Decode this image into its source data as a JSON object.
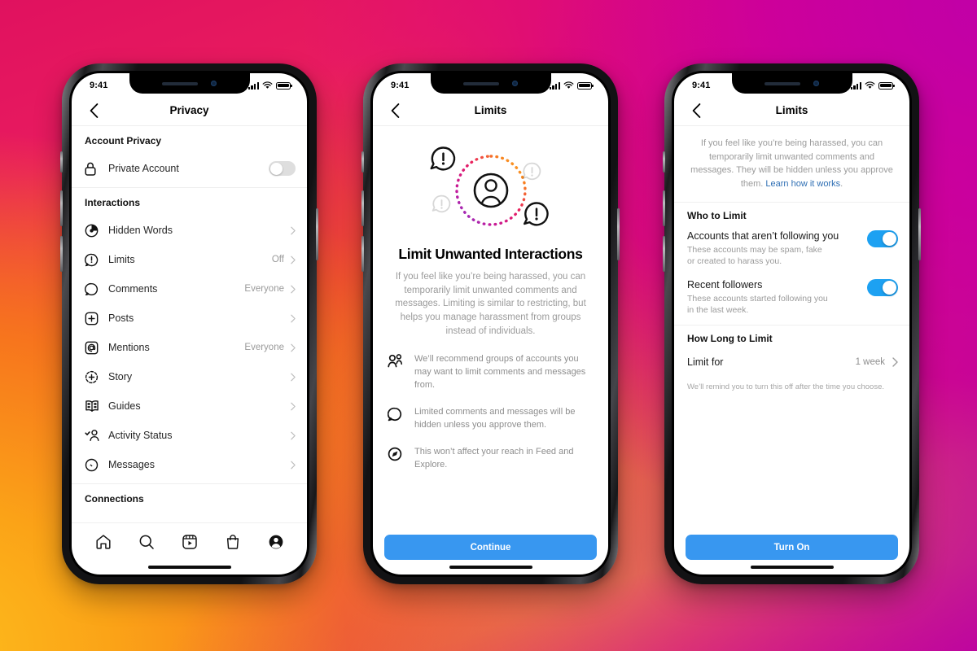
{
  "background": {
    "gradient_from": "#e0115f",
    "gradient_mid": "#f8891c",
    "gradient_to": "#b800b0"
  },
  "theme": {
    "accent_blue": "#3897f0",
    "toggle_on_blue": "#1da1f2",
    "toggle_off_gray": "#dedede",
    "link_blue": "#2f6fb4",
    "text_primary": "#262626",
    "text_muted": "#9b9b9b"
  },
  "phones": [
    {
      "id": "phone-privacy",
      "status_bar": {
        "time": "9:41",
        "signal": "signal-bars-icon",
        "wifi": "wifi-icon",
        "battery": "battery-full-icon"
      },
      "nav": {
        "back": "chevron-left-icon",
        "title": "Privacy"
      },
      "sections": [
        {
          "id": "account-privacy",
          "header": "Account Privacy",
          "rows": [
            {
              "icon": "lock-icon",
              "label": "Private Account",
              "value": "",
              "control": "toggle-off"
            }
          ]
        },
        {
          "id": "interactions",
          "header": "Interactions",
          "rows": [
            {
              "icon": "hidden-words-icon",
              "label": "Hidden Words",
              "value": "",
              "control": "chevron"
            },
            {
              "icon": "limits-icon",
              "label": "Limits",
              "value": "Off",
              "control": "chevron"
            },
            {
              "icon": "comment-icon",
              "label": "Comments",
              "value": "Everyone",
              "control": "chevron"
            },
            {
              "icon": "posts-plus-icon",
              "label": "Posts",
              "value": "",
              "control": "chevron"
            },
            {
              "icon": "mentions-at-icon",
              "label": "Mentions",
              "value": "Everyone",
              "control": "chevron"
            },
            {
              "icon": "story-plus-icon",
              "label": "Story",
              "value": "",
              "control": "chevron"
            },
            {
              "icon": "guides-book-icon",
              "label": "Guides",
              "value": "",
              "control": "chevron"
            },
            {
              "icon": "activity-status-icon",
              "label": "Activity Status",
              "value": "",
              "control": "chevron"
            },
            {
              "icon": "messenger-icon",
              "label": "Messages",
              "value": "",
              "control": "chevron"
            }
          ]
        },
        {
          "id": "connections",
          "header": "Connections",
          "rows": []
        }
      ],
      "tabbar": [
        {
          "icon": "home-icon",
          "name": "tab-home"
        },
        {
          "icon": "search-icon",
          "name": "tab-search"
        },
        {
          "icon": "reels-icon",
          "name": "tab-reels"
        },
        {
          "icon": "shop-bag-icon",
          "name": "tab-shop"
        },
        {
          "icon": "profile-avatar-icon",
          "name": "tab-profile"
        }
      ]
    },
    {
      "id": "phone-limits-intro",
      "status_bar": {
        "time": "9:41"
      },
      "nav": {
        "back": "chevron-left-icon",
        "title": "Limits"
      },
      "illustration": {
        "name": "limit-unwanted-interactions-illustration",
        "center_icon": "person-circle-icon",
        "ring": "dotted-gradient-ring",
        "bubbles": [
          "exclamation-bubble-dark",
          "exclamation-bubble-faint",
          "exclamation-bubble-faint",
          "exclamation-bubble-dark"
        ]
      },
      "title": "Limit Unwanted Interactions",
      "subtitle": "If you feel like you’re being harassed, you can temporarily limit unwanted comments and messages. Limiting is similar to restricting, but helps you manage harassment from groups instead of individuals.",
      "features": [
        {
          "icon": "two-people-icon",
          "text": "We’ll recommend groups of accounts you may want to limit comments and messages from."
        },
        {
          "icon": "comment-bubble-icon",
          "text": "Limited comments and messages will be hidden unless you approve them."
        },
        {
          "icon": "compass-explore-icon",
          "text": "This won’t affect your reach in Feed and Explore."
        }
      ],
      "cta": {
        "label": "Continue"
      }
    },
    {
      "id": "phone-limits-settings",
      "status_bar": {
        "time": "9:41"
      },
      "nav": {
        "back": "chevron-left-icon",
        "title": "Limits"
      },
      "intro": {
        "text": "If you feel like you’re being harassed, you can temporarily limit unwanted comments and messages. They will be hidden unless you approve them. ",
        "link": "Learn how it works",
        "suffix": "."
      },
      "who_to_limit": {
        "header": "Who to Limit",
        "options": [
          {
            "title": "Accounts that aren’t following you",
            "desc": "These accounts may be spam, fake or created to harass you.",
            "toggle": "on"
          },
          {
            "title": "Recent followers",
            "desc": "These accounts started following you in the last week.",
            "toggle": "on"
          }
        ]
      },
      "how_long_to_limit": {
        "header": "How Long to Limit",
        "row": {
          "label": "Limit for",
          "value": "1 week"
        },
        "note": "We’ll remind you to turn this off after the time you choose."
      },
      "cta": {
        "label": "Turn On"
      }
    }
  ]
}
